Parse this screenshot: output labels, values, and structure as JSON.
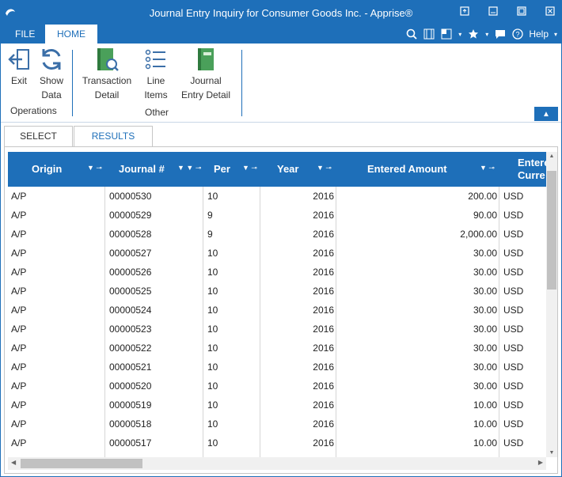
{
  "window": {
    "title": "Journal Entry Inquiry for Consumer Goods Inc. - Apprise®",
    "accent": "#1e6fb9"
  },
  "ribbon_tabs": {
    "file": "FILE",
    "home": "HOME"
  },
  "qat": {
    "help_label": "Help"
  },
  "ribbon": {
    "exit": "Exit",
    "show_data_1": "Show",
    "show_data_2": "Data",
    "operations_label": "Operations",
    "transaction_detail_1": "Transaction",
    "transaction_detail_2": "Detail",
    "line_items_1": "Line",
    "line_items_2": "Items",
    "journal_entry_detail_1": "Journal",
    "journal_entry_detail_2": "Entry Detail",
    "other_label": "Other"
  },
  "page_tabs": {
    "select": "SELECT",
    "results": "RESULTS"
  },
  "columns": {
    "origin": "Origin",
    "journal": "Journal #",
    "per": "Per",
    "year": "Year",
    "entered_amount": "Entered Amount",
    "entered_currency_1": "Entere",
    "entered_currency_2": "Curre"
  },
  "rows": [
    {
      "origin": "A/P",
      "journal": "00000530",
      "per": "10",
      "year": "2016",
      "amount": "200.00",
      "currency": "USD"
    },
    {
      "origin": "A/P",
      "journal": "00000529",
      "per": "9",
      "year": "2016",
      "amount": "90.00",
      "currency": "USD"
    },
    {
      "origin": "A/P",
      "journal": "00000528",
      "per": "9",
      "year": "2016",
      "amount": "2,000.00",
      "currency": "USD"
    },
    {
      "origin": "A/P",
      "journal": "00000527",
      "per": "10",
      "year": "2016",
      "amount": "30.00",
      "currency": "USD"
    },
    {
      "origin": "A/P",
      "journal": "00000526",
      "per": "10",
      "year": "2016",
      "amount": "30.00",
      "currency": "USD"
    },
    {
      "origin": "A/P",
      "journal": "00000525",
      "per": "10",
      "year": "2016",
      "amount": "30.00",
      "currency": "USD"
    },
    {
      "origin": "A/P",
      "journal": "00000524",
      "per": "10",
      "year": "2016",
      "amount": "30.00",
      "currency": "USD"
    },
    {
      "origin": "A/P",
      "journal": "00000523",
      "per": "10",
      "year": "2016",
      "amount": "30.00",
      "currency": "USD"
    },
    {
      "origin": "A/P",
      "journal": "00000522",
      "per": "10",
      "year": "2016",
      "amount": "30.00",
      "currency": "USD"
    },
    {
      "origin": "A/P",
      "journal": "00000521",
      "per": "10",
      "year": "2016",
      "amount": "30.00",
      "currency": "USD"
    },
    {
      "origin": "A/P",
      "journal": "00000520",
      "per": "10",
      "year": "2016",
      "amount": "30.00",
      "currency": "USD"
    },
    {
      "origin": "A/P",
      "journal": "00000519",
      "per": "10",
      "year": "2016",
      "amount": "10.00",
      "currency": "USD"
    },
    {
      "origin": "A/P",
      "journal": "00000518",
      "per": "10",
      "year": "2016",
      "amount": "10.00",
      "currency": "USD"
    },
    {
      "origin": "A/P",
      "journal": "00000517",
      "per": "10",
      "year": "2016",
      "amount": "10.00",
      "currency": "USD"
    }
  ]
}
